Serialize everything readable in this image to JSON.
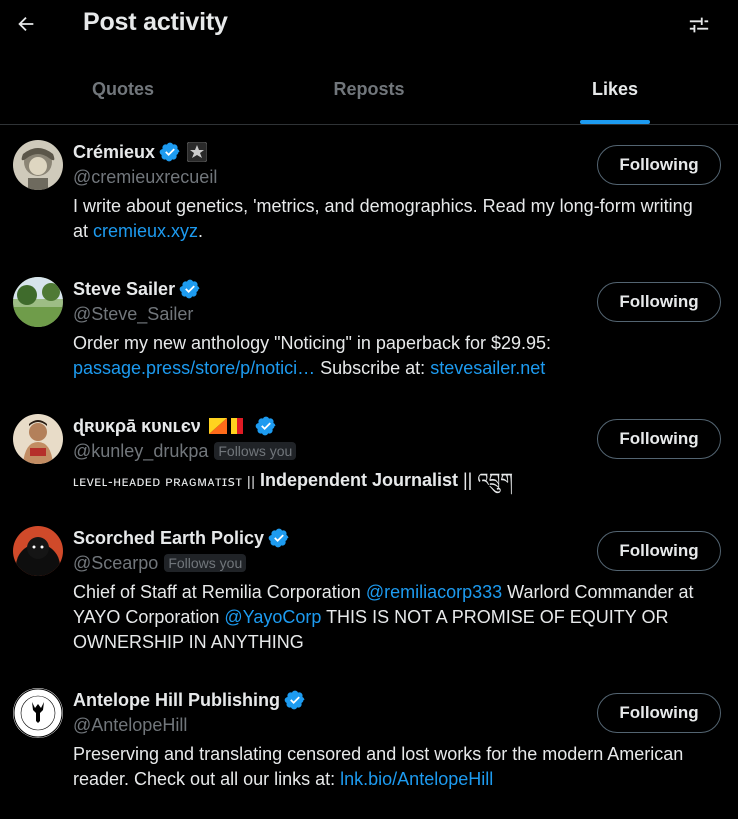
{
  "header": {
    "title": "Post activity",
    "back_icon": "arrow-left-icon",
    "filter_icon": "sliders-icon"
  },
  "tabs": [
    {
      "label": "Quotes",
      "active": false
    },
    {
      "label": "Reposts",
      "active": false
    },
    {
      "label": "Likes",
      "active": true
    }
  ],
  "colors": {
    "accent": "#1d9bf0",
    "muted": "#71767b",
    "text": "#e7e9ea",
    "background": "#000000"
  },
  "users": [
    {
      "name": "Crémieux",
      "handle": "@cremieuxrecueil",
      "follows_you": "",
      "button": "Following",
      "bio_text": "I write about genetics, 'metrics, and demographics. Read my long-form writing at ",
      "bio_link": "cremieux.xyz",
      "bio_end": "."
    },
    {
      "name": "Steve Sailer",
      "handle": "@Steve_Sailer",
      "follows_you": "",
      "button": "Following",
      "bio_text": "Order my new anthology \"Noticing\" in paperback for $29.95: ",
      "bio_link": "passage.press/store/p/notici…",
      "bio_mid": " Subscribe at: ",
      "bio_link2": "stevesailer.net"
    },
    {
      "name": "ɖʀυĸρā̄ ĸυɴʟєν",
      "flag": "🏃🇧🇹",
      "handle": "@kunley_drukpa",
      "follows_you": "Follows you",
      "button": "Following",
      "bio_part1": "ʟᴇᴠᴇʟ-ʜᴇᴀᴅᴇᴅ ᴘʀᴀɢᴍᴀᴛɪꜱᴛ || ",
      "bio_part2": "Independent Journalist",
      "bio_part3": " || འབྲུག"
    },
    {
      "name": "Scorched Earth Policy",
      "handle": "@Scearpo",
      "follows_you": "Follows you",
      "button": "Following",
      "bio_text": "Chief of Staff at Remilia Corporation ",
      "bio_link": "@remiliacorp333",
      "bio_mid": " Warlord Commander at YAYO Corporation ",
      "bio_link2": "@YayoCorp",
      "bio_end": " THIS IS NOT A PROMISE OF EQUITY OR OWNERSHIP IN ANYTHING"
    },
    {
      "name": "Antelope Hill Publishing",
      "handle": "@AntelopeHill",
      "follows_you": "",
      "button": "Following",
      "bio_text": "Preserving and translating censored and lost works for the modern American reader. Check out all our links at: ",
      "bio_link": "lnk.bio/AntelopeHill"
    }
  ]
}
